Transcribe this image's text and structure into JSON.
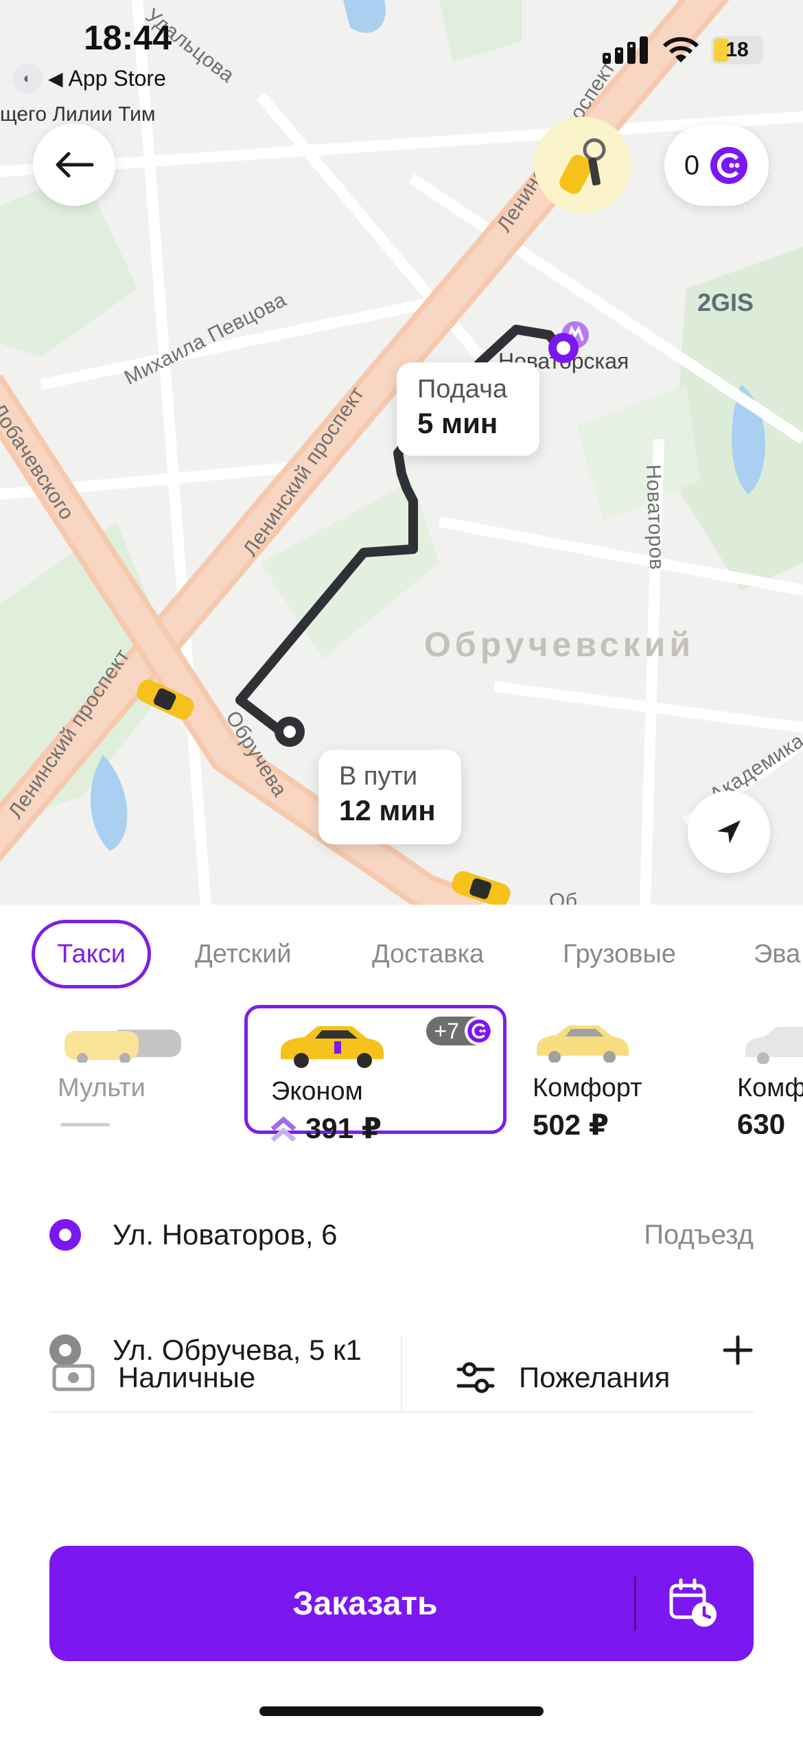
{
  "status_bar": {
    "time": "18:44",
    "back_app": "App Store",
    "battery": "18"
  },
  "map": {
    "truncated_label": "щего Лилии Тим",
    "streets": {
      "udaltsova": "Удальцова",
      "leninsky_top": "Ленинский проспект",
      "mikhaila_pevtsova": "Михаила Певцова",
      "leninsky_mid": "Ленинский проспект",
      "lobachevskogo": "Лобачевского",
      "leninsky_low": "Ленинский проспект",
      "obrucheva": "Обручева",
      "novatorov": "Новаторов",
      "akademika": "Академика",
      "ob_bottom": "Об"
    },
    "metro_station": "Новаторская",
    "district": "Обручевский",
    "brand": "2GIS",
    "pickup_bubble": {
      "label": "Подача",
      "value": "5 мин"
    },
    "trip_bubble": {
      "label": "В пути",
      "value": "12 мин"
    },
    "points_balance": "0"
  },
  "tabs": [
    {
      "label": "Такси",
      "active": true
    },
    {
      "label": "Детский"
    },
    {
      "label": "Доставка"
    },
    {
      "label": "Грузовые"
    },
    {
      "label": "Эва"
    }
  ],
  "tariffs": [
    {
      "name": "Мульти",
      "price": ""
    },
    {
      "name": "Эконом",
      "price": "391 ₽",
      "selected": true,
      "badge": "+7"
    },
    {
      "name": "Комфорт",
      "price": "502 ₽"
    },
    {
      "name": "Комф",
      "price": "630"
    }
  ],
  "route": {
    "from": {
      "address": "Ул. Новаторов, 6",
      "extra": "Подъезд"
    },
    "to": {
      "address": "Ул. Обручева, 5 к1",
      "extra": "+"
    }
  },
  "payment": {
    "method": "Наличные",
    "wishes": "Пожелания"
  },
  "order_button": {
    "label": "Заказать"
  },
  "colors": {
    "accent": "#7b17f0",
    "route": "#2f3136",
    "taxi": "#f4c21a",
    "road": "#f4c6a8"
  }
}
